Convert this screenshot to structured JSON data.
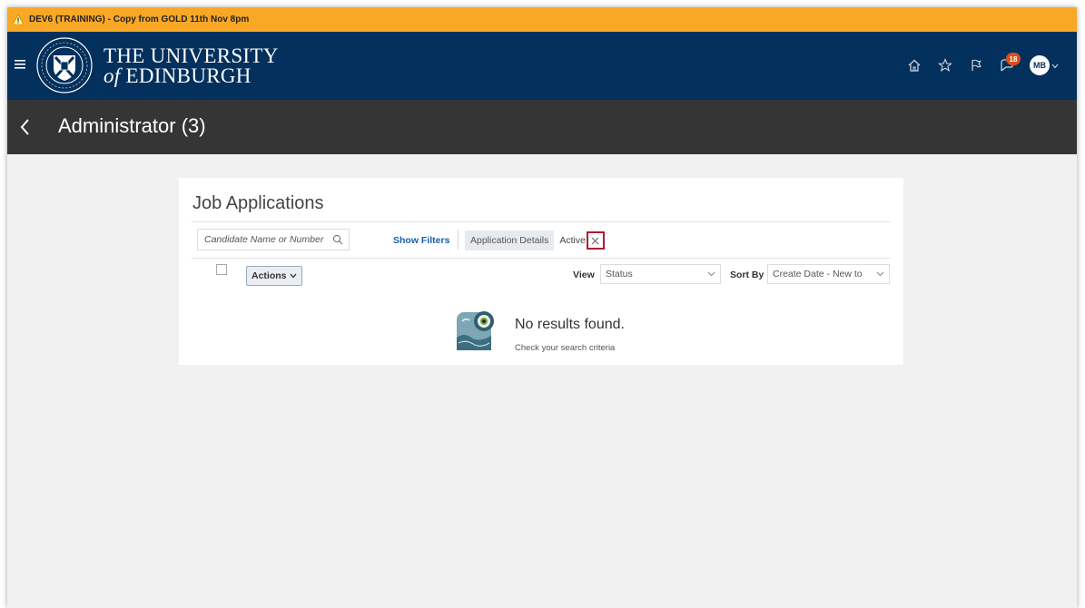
{
  "env_banner": {
    "text": "DEV6 (TRAINING) - Copy from GOLD 11th Nov 8pm",
    "icon": "warning-icon"
  },
  "header": {
    "line1": "THE UNIVERSITY",
    "line2_of": "of",
    "line2_rest": " EDINBURGH",
    "notifications_count": "18",
    "avatar_initials": "MB",
    "colors": {
      "header_bg": "#03305c",
      "banner_bg": "#f9a825",
      "badge": "#d9501c"
    }
  },
  "titlebar": {
    "title": "Administrator (3)"
  },
  "card": {
    "title": "Job Applications",
    "search_placeholder": "Candidate Name or Number",
    "show_filters": "Show Filters",
    "chip_label": "Application Details",
    "chip_value": "Active",
    "actions_label": "Actions",
    "view_label": "View",
    "view_value": "Status",
    "sort_label": "Sort By",
    "sort_value": "Create Date - New to",
    "no_results_title": "No results found.",
    "no_results_sub": "Check your search criteria"
  }
}
